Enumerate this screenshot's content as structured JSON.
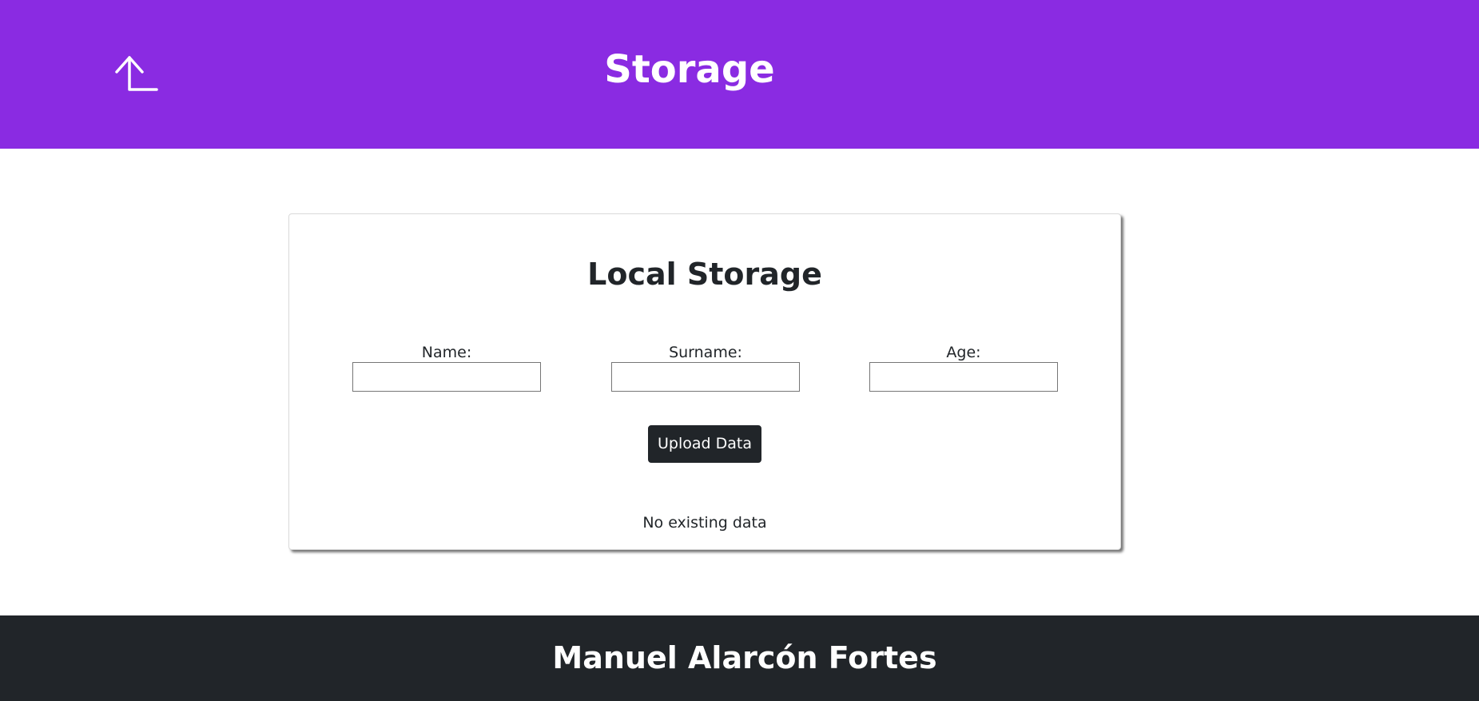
{
  "header": {
    "title": "Storage",
    "back_icon": "corner-left-up-icon",
    "background_color": "#8a2be2"
  },
  "card": {
    "title": "Local Storage",
    "fields": {
      "name": {
        "label": "Name:",
        "value": ""
      },
      "surname": {
        "label": "Surname:",
        "value": ""
      },
      "age": {
        "label": "Age:",
        "value": ""
      }
    },
    "upload_label": "Upload Data",
    "status": "No existing data"
  },
  "footer": {
    "text": "Manuel Alarcón Fortes",
    "background_color": "#212529"
  }
}
